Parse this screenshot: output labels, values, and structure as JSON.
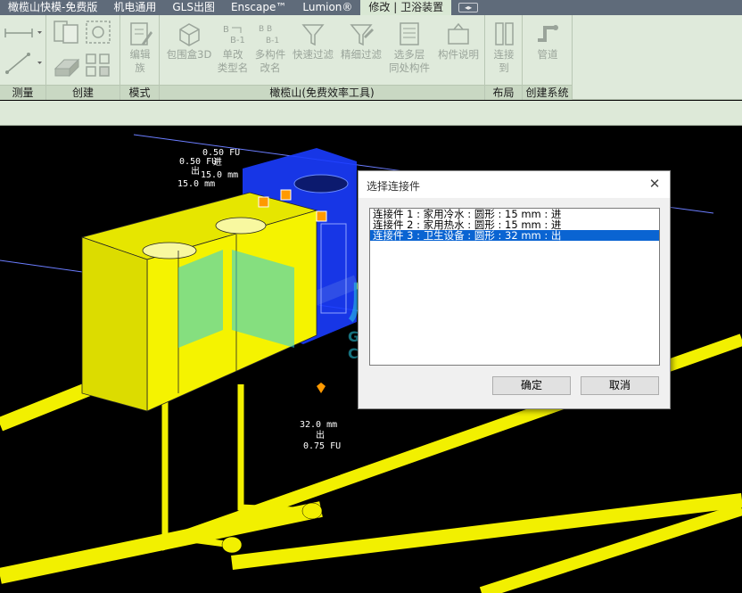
{
  "tabs": [
    {
      "label": "橄榄山快模-免费版",
      "active": false
    },
    {
      "label": "机电通用",
      "active": false
    },
    {
      "label": "GLS出图",
      "active": false
    },
    {
      "label": "Enscape™",
      "active": false
    },
    {
      "label": "Lumion®",
      "active": false
    },
    {
      "label": "修改 | 卫浴装置",
      "active": true
    }
  ],
  "ribbon": {
    "panels": {
      "measure": "测量",
      "create": "创建",
      "mode": "模式",
      "olive": "橄榄山(免费效率工具)",
      "layout": "布局",
      "create_system": "创建系统"
    },
    "tools": {
      "edit_family": "编辑\n族",
      "bbox3d": "包围盒3D",
      "change_type_name": "单改\n类型名",
      "multi_rename": "多构件\n改名",
      "quick_filter": "快速过滤",
      "fine_filter": "精细过滤",
      "multi_level": "选多层\n同处构件",
      "component_desc": "构件说明",
      "connect_to": "连接\n到",
      "pipe": "管道"
    }
  },
  "viewport": {
    "annotations": {
      "fu_top": "0.50 FU",
      "in_label": "进",
      "fu_mid": "0.50 FU",
      "out_label": "出",
      "mm_a": "15.0 mm",
      "mm_b": "15.0 mm",
      "bottom_mm": "32.0 mm",
      "bottom_out": "出",
      "bottom_fu": "0.75 FU"
    },
    "colors": {
      "fixture": "#f2f000",
      "selected_fixture": "#1a3cff",
      "pipe": "#f2f000",
      "connector": "#ff9a00",
      "gridline": "#6b7dff"
    }
  },
  "dialog": {
    "title": "选择连接件",
    "items": [
      {
        "text": "连接件 1 : 家用冷水 : 圆形 : 15 mm : 进",
        "selected": false
      },
      {
        "text": "连接件 2 : 家用热水 : 圆形 : 15 mm : 进",
        "selected": false
      },
      {
        "text": "连接件 3 : 卫生设备 : 圆形 : 32 mm : 出",
        "selected": true
      }
    ],
    "ok_label": "确定",
    "cancel_label": "取消"
  },
  "watermark": {
    "cn": "广筑咨询",
    "en": "GUANGZHU CONSULTATION"
  }
}
